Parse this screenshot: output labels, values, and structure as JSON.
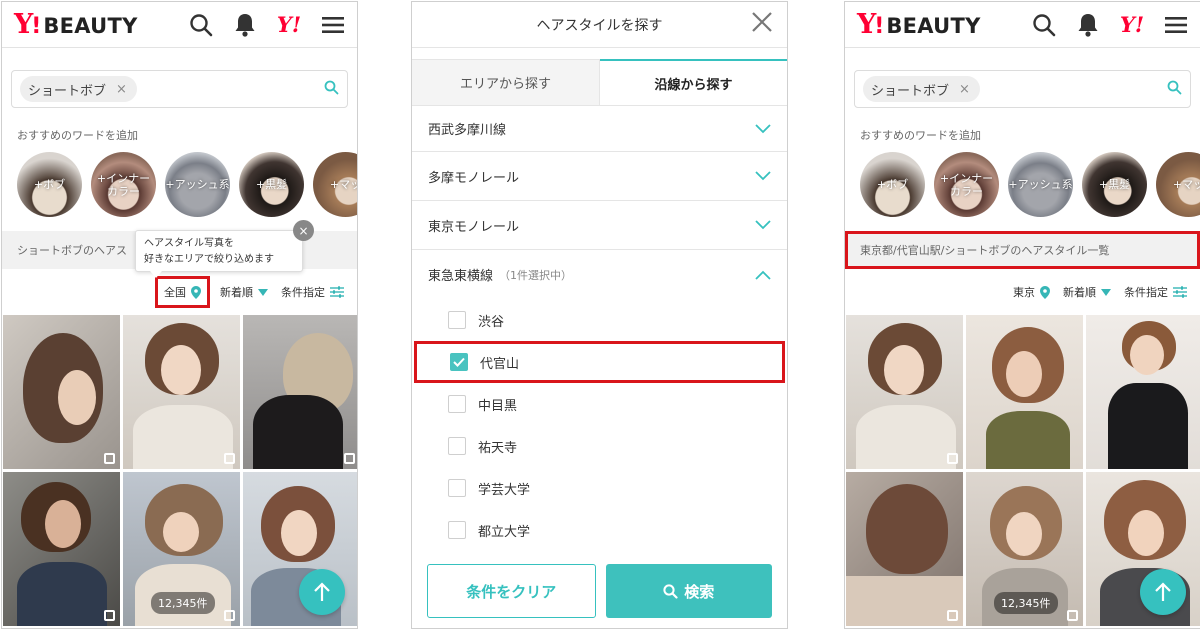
{
  "header": {
    "logo_y": "Y",
    "logo_bang": "!",
    "logo_text": "BEAUTY",
    "yjapan_label": "Y!",
    "icons": [
      "search-icon",
      "bell-icon",
      "menu-icon"
    ]
  },
  "left": {
    "search_chip": "ショートボブ",
    "chip_remove": "×",
    "suggest_title": "おすすめのワードを追加",
    "suggestions": [
      "+ボブ",
      "+インナー\nカラー",
      "+アッシュ系",
      "+黒髪",
      "+マッ"
    ],
    "info_text": "ショートボブのヘアス",
    "tooltip_line1": "ヘアスタイル写真を",
    "tooltip_line2": "好きなエリアで絞り込めます",
    "tooltip_close": "×",
    "filter_area": "全国",
    "filter_sort": "新着順",
    "filter_condition": "条件指定",
    "photo_count": "12,345件"
  },
  "modal": {
    "title": "ヘアスタイルを探す",
    "close": "✕",
    "tab_area": "エリアから探す",
    "tab_line": "沿線から探す",
    "lines": [
      {
        "name": "西武多摩川線"
      },
      {
        "name": "多摩モノレール"
      },
      {
        "name": "東京モノレール"
      },
      {
        "name": "東急東横線",
        "note": "（1件選択中）"
      }
    ],
    "stations": [
      {
        "name": "渋谷",
        "checked": false
      },
      {
        "name": "代官山",
        "checked": true
      },
      {
        "name": "中目黒",
        "checked": false
      },
      {
        "name": "祐天寺",
        "checked": false
      },
      {
        "name": "学芸大学",
        "checked": false
      },
      {
        "name": "都立大学",
        "checked": false
      }
    ],
    "clear_label": "条件をクリア",
    "search_label": "検索"
  },
  "right": {
    "search_chip": "ショートボブ",
    "chip_remove": "×",
    "suggest_title": "おすすめのワードを追加",
    "suggestions": [
      "+ボブ",
      "+インナー\nカラー",
      "+アッシュ系",
      "+黒髪",
      "+マッ"
    ],
    "info_text": "東京都/代官山駅/ショートボブのヘアスタイル一覧",
    "filter_area": "東京",
    "filter_sort": "新着順",
    "filter_condition": "条件指定",
    "photo_count": "12,345件"
  },
  "colors": {
    "accent": "#36c1bf",
    "highlight_box": "#d9151b",
    "brand_red": "#ff0033"
  }
}
